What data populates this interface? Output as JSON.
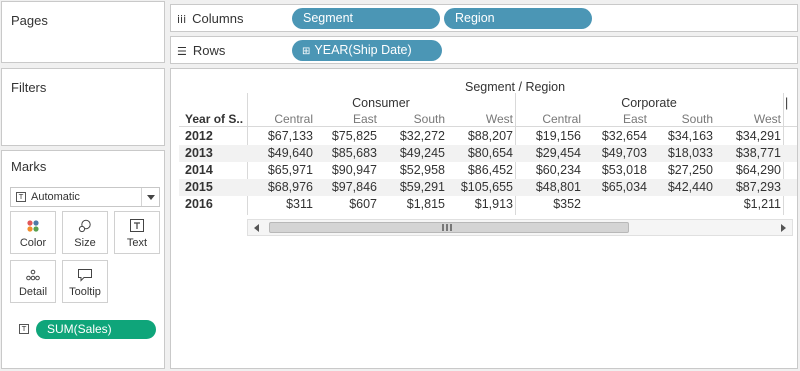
{
  "sidebar": {
    "pages_title": "Pages",
    "filters_title": "Filters",
    "marks_title": "Marks",
    "mark_type": "Automatic",
    "mark_buttons": [
      {
        "label": "Color",
        "icon": "color-dots-icon"
      },
      {
        "label": "Size",
        "icon": "size-circles-icon"
      },
      {
        "label": "Text",
        "icon": "text-box-icon"
      },
      {
        "label": "Detail",
        "icon": "detail-dots-icon"
      },
      {
        "label": "Tooltip",
        "icon": "tooltip-bubble-icon"
      }
    ],
    "measure_pill": "SUM(Sales)"
  },
  "shelves": {
    "columns_label": "Columns",
    "columns_pills": [
      "Segment",
      "Region"
    ],
    "rows_label": "Rows",
    "rows_pills": [
      "YEAR(Ship Date)"
    ]
  },
  "colors": {
    "dimension_pill": "#4b96b5",
    "measure_pill": "#0fa57a",
    "band_row": "#f2f2f2"
  },
  "table": {
    "header_title": "Segment / Region",
    "row_header": "Year of S..",
    "segments": [
      "Consumer",
      "Corporate"
    ],
    "regions": [
      "Central",
      "East",
      "South",
      "West",
      "Central",
      "East",
      "South",
      "West"
    ],
    "rows": [
      {
        "year": "2012",
        "values": [
          "$67,133",
          "$75,825",
          "$32,272",
          "$88,207",
          "$19,156",
          "$32,654",
          "$34,163",
          "$34,291"
        ]
      },
      {
        "year": "2013",
        "values": [
          "$49,640",
          "$85,683",
          "$49,245",
          "$80,654",
          "$29,454",
          "$49,703",
          "$18,033",
          "$38,771"
        ]
      },
      {
        "year": "2014",
        "values": [
          "$65,971",
          "$90,947",
          "$52,958",
          "$86,452",
          "$60,234",
          "$53,018",
          "$27,250",
          "$64,290"
        ]
      },
      {
        "year": "2015",
        "values": [
          "$68,976",
          "$97,846",
          "$59,291",
          "$105,655",
          "$48,801",
          "$65,034",
          "$42,440",
          "$87,293"
        ]
      },
      {
        "year": "2016",
        "values": [
          "$311",
          "$607",
          "$1,815",
          "$1,913",
          "$352",
          "",
          "",
          "$1,211"
        ]
      }
    ]
  }
}
